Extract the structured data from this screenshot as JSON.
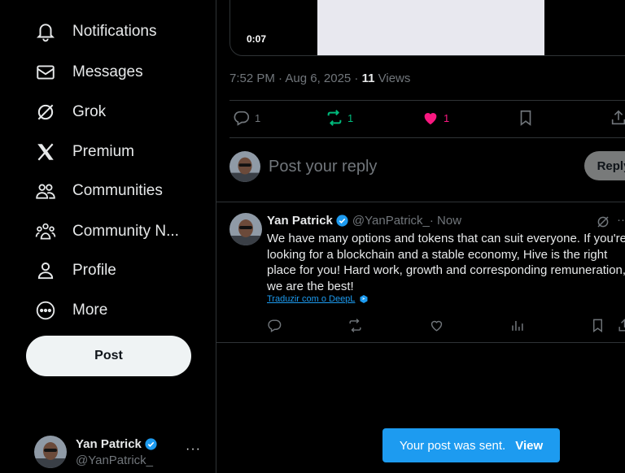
{
  "nav": {
    "items": [
      {
        "label": "Notifications",
        "icon": "bell-icon"
      },
      {
        "label": "Messages",
        "icon": "envelope-icon"
      },
      {
        "label": "Grok",
        "icon": "grok-icon"
      },
      {
        "label": "Premium",
        "icon": "x-logo-icon"
      },
      {
        "label": "Communities",
        "icon": "communities-icon"
      },
      {
        "label": "Community N...",
        "icon": "community-notes-icon"
      },
      {
        "label": "Profile",
        "icon": "person-icon"
      },
      {
        "label": "More",
        "icon": "more-circle-icon"
      }
    ],
    "post_label": "Post"
  },
  "account": {
    "name": "Yan Patrick",
    "handle": "@YanPatrick_",
    "more": "···"
  },
  "media": {
    "timer": "0:07"
  },
  "post_meta": {
    "time": "7:52 PM · Aug 6, 2025 · ",
    "views_count": "11",
    "views_label": " Views"
  },
  "post_actions": {
    "replies": "1",
    "reposts": "1",
    "likes": "1",
    "colors": {
      "repost": "#00ba7c",
      "like": "#f91880"
    }
  },
  "reply_box": {
    "placeholder": "Post your reply",
    "button_label": "Reply"
  },
  "reply_tweet": {
    "name": "Yan Patrick",
    "handle": "@YanPatrick_",
    "time": " · Now",
    "text": "We have many options and tokens that can suit everyone. If you're looking for a blockchain and a stable economy, Hive is the right place for you! Hard work, growth and corresponding remuneration, we are the best!",
    "translate_label": "Traduzir com o DeepL"
  },
  "toast": {
    "message": "Your post was sent.",
    "action": "View"
  },
  "colors": {
    "accent": "#1d9bf0",
    "background": "#000000",
    "border": "#2f3336",
    "muted": "#71767b"
  }
}
